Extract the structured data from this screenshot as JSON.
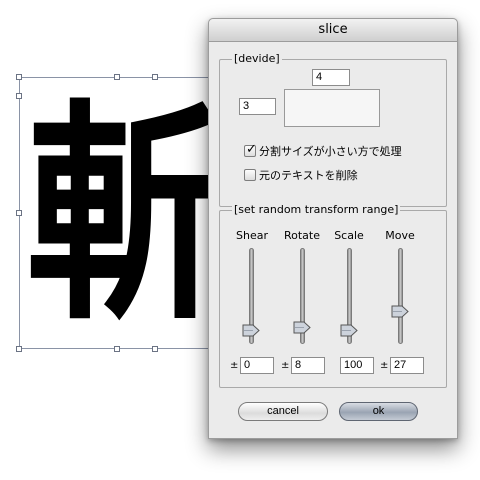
{
  "dialog": {
    "title": "slice",
    "divide_group": {
      "title": "[devide]",
      "columns_value": "4",
      "rows_value": "3",
      "checkbox_shrink": {
        "label": "分割サイズが小さい方で処理",
        "checked": true
      },
      "checkbox_delete": {
        "label": "元のテキストを削除",
        "checked": false
      }
    },
    "transform_group": {
      "title": "[set random transform range]",
      "plus_minus": "±",
      "sliders": [
        {
          "label": "Shear",
          "value": "0",
          "level": 0.05
        },
        {
          "label": "Rotate",
          "value": "8",
          "level": 0.08
        },
        {
          "label": "Scale",
          "value": "100",
          "level": 0.05
        },
        {
          "label": "Move",
          "value": "27",
          "level": 0.27
        }
      ]
    },
    "buttons": {
      "cancel": "cancel",
      "ok": "ok"
    }
  },
  "canvas": {
    "glyph": "斬"
  }
}
